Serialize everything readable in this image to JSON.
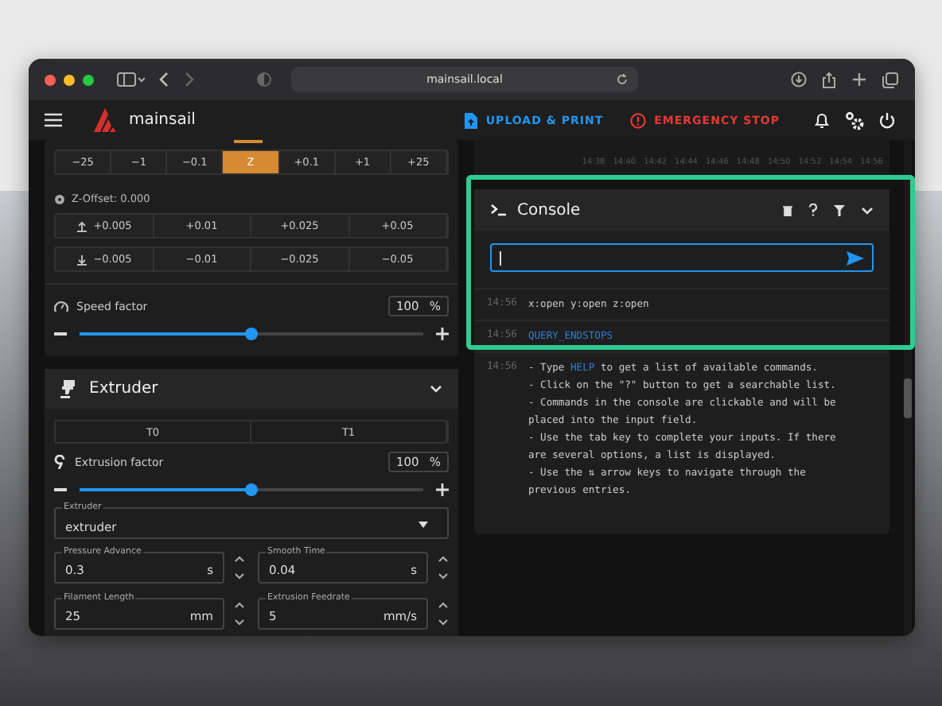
{
  "browser": {
    "url": "mainsail.local"
  },
  "app": {
    "name": "mainsail",
    "upload_label": "UPLOAD & PRINT",
    "estop_label": "EMERGENCY STOP"
  },
  "move_buttons": [
    {
      "label": "−25",
      "selected": false
    },
    {
      "label": "−1",
      "selected": false
    },
    {
      "label": "−0.1",
      "selected": false
    },
    {
      "label": "Z",
      "selected": true
    },
    {
      "label": "+0.1",
      "selected": false
    },
    {
      "label": "+1",
      "selected": false
    },
    {
      "label": "+25",
      "selected": false
    }
  ],
  "z_offset": {
    "label": "Z-Offset: 0.000",
    "raise": [
      "+0.005",
      "+0.01",
      "+0.025",
      "+0.05"
    ],
    "lower": [
      "−0.005",
      "−0.01",
      "−0.025",
      "−0.05"
    ]
  },
  "speed": {
    "label": "Speed factor",
    "value": "100",
    "unit": "%",
    "level": 0.5
  },
  "extruder": {
    "title": "Extruder",
    "tools": [
      "T0",
      "T1"
    ],
    "factor": {
      "label": "Extrusion factor",
      "value": "100",
      "unit": "%",
      "level": 0.5
    },
    "select": {
      "label": "Extruder",
      "value": "extruder"
    },
    "fields": [
      {
        "label": "Pressure Advance",
        "value": "0.3",
        "unit": "s"
      },
      {
        "label": "Smooth Time",
        "value": "0.04",
        "unit": "s"
      },
      {
        "label": "Filament Length",
        "value": "25",
        "unit": "mm"
      },
      {
        "label": "Extrusion Feedrate",
        "value": "5",
        "unit": "mm/s"
      }
    ]
  },
  "chart_axis": [
    "14:38",
    "14:40",
    "14:42",
    "14:44",
    "14:46",
    "14:48",
    "14:50",
    "14:52",
    "14:54",
    "14:56"
  ],
  "console": {
    "title": "Console",
    "entries": [
      {
        "time": "14:56",
        "lines": [
          [
            {
              "kind": "plain",
              "text": "x:open y:open z:open"
            }
          ]
        ]
      },
      {
        "time": "14:56",
        "lines": [
          [
            {
              "kind": "command",
              "text": "QUERY_ENDSTOPS"
            }
          ]
        ]
      },
      {
        "time": "14:56",
        "lines": [
          [
            {
              "kind": "plain",
              "text": "- Type "
            },
            {
              "kind": "command",
              "text": "HELP"
            },
            {
              "kind": "plain",
              "text": " to get a list of available commands."
            }
          ],
          [
            {
              "kind": "plain",
              "text": "- Click on the \"?\" button to get a searchable list."
            }
          ],
          [
            {
              "kind": "plain",
              "text": "- Commands in the console are clickable and will be"
            }
          ],
          [
            {
              "kind": "plain",
              "text": "placed into the input field."
            }
          ],
          [
            {
              "kind": "plain",
              "text": "- Use the tab key to complete your inputs. If there"
            }
          ],
          [
            {
              "kind": "plain",
              "text": "are several options, a list is displayed."
            }
          ],
          [
            {
              "kind": "plain",
              "text": "- Use the ⇅ arrow keys to navigate through the"
            }
          ],
          [
            {
              "kind": "plain",
              "text": "previous entries."
            }
          ]
        ]
      }
    ]
  }
}
